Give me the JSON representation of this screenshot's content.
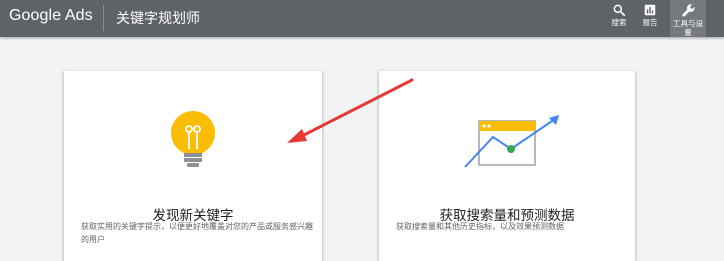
{
  "header": {
    "brand": "Google Ads",
    "tool_title": "关键字规划师",
    "nav": [
      {
        "label": "搜索",
        "icon": "search-icon"
      },
      {
        "label": "报告",
        "icon": "bar-chart-icon"
      },
      {
        "label": "工具与设置",
        "icon": "wrench-icon"
      }
    ]
  },
  "cards": [
    {
      "title": "发现新关键字",
      "description": "获取实用的关键字提示，以便更好地覆盖对您的产品或服务感兴趣的用户",
      "icon": "lightbulb-icon"
    },
    {
      "title": "获取搜索量和预测数据",
      "description": "获取搜索量和其他历史指标，以及效果预测数据",
      "icon": "chart-window-icon"
    }
  ],
  "annotation": {
    "icon": "red-arrow-icon"
  },
  "colors": {
    "topbar": "#5f6368",
    "bulb": "#fbbc04",
    "arrow": "#e53935",
    "trend": "#4285f4",
    "dot": "#34a853"
  }
}
